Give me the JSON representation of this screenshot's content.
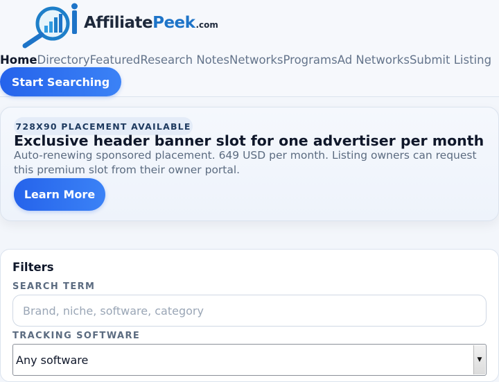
{
  "logo": {
    "brand_a": "Affiliate",
    "brand_b": "Peek",
    "brand_suffix": ".com"
  },
  "nav": {
    "items": [
      "Home",
      "Directory",
      "Featured",
      "Research Notes",
      "Networks",
      "Programs",
      "Ad Networks",
      "Submit Listing"
    ],
    "active": "Home"
  },
  "cta": {
    "start_label": "Start Searching"
  },
  "promo": {
    "badge": "728X90 PLACEMENT AVAILABLE",
    "title": "Exclusive header banner slot for one advertiser per month",
    "description": "Auto-renewing sponsored placement. 649 USD per month. Listing owners can request this premium slot from their owner portal.",
    "button_label": "Learn More"
  },
  "filters": {
    "title": "Filters",
    "search_label": "SEARCH TERM",
    "search_placeholder": "Brand, niche, software, category",
    "search_value": "",
    "software_label": "TRACKING SOFTWARE",
    "software_selected": "Any software"
  },
  "colors": {
    "accent": "#2563eb",
    "brand_blue": "#1e74c8",
    "text_dark": "#0f172a",
    "text_muted": "#64748b"
  }
}
